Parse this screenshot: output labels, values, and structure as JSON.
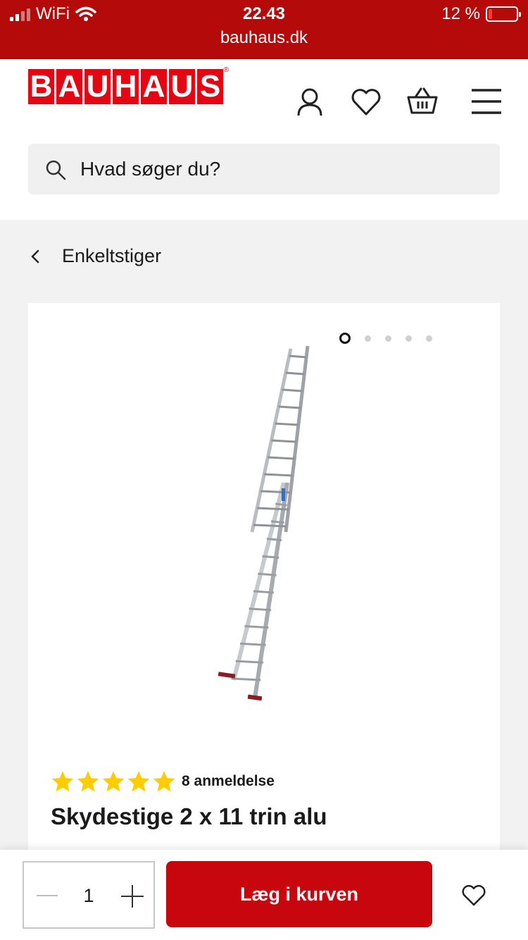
{
  "status_bar": {
    "carrier": "WiFi",
    "time": "22.43",
    "url": "bauhaus.dk",
    "battery_text": "12 %",
    "battery_level": 0.12
  },
  "header": {
    "logo_letters": [
      "B",
      "A",
      "U",
      "H",
      "A",
      "U",
      "S"
    ],
    "icons": [
      "user-icon",
      "heart-icon",
      "basket-icon",
      "menu-icon"
    ]
  },
  "search": {
    "placeholder": "Hvad søger du?"
  },
  "breadcrumb": {
    "label": "Enkeltstiger"
  },
  "product": {
    "image_count": 5,
    "active_image": 1,
    "rating": 5,
    "reviews_label": "8 anmeldelse",
    "title": "Skydestige 2 x 11 trin alu"
  },
  "bottom_bar": {
    "quantity": "1",
    "add_to_cart_label": "Læg i kurven"
  },
  "colors": {
    "brand_red": "#b50a0a",
    "button_red": "#c8060e",
    "star_yellow": "#ffcc00"
  }
}
